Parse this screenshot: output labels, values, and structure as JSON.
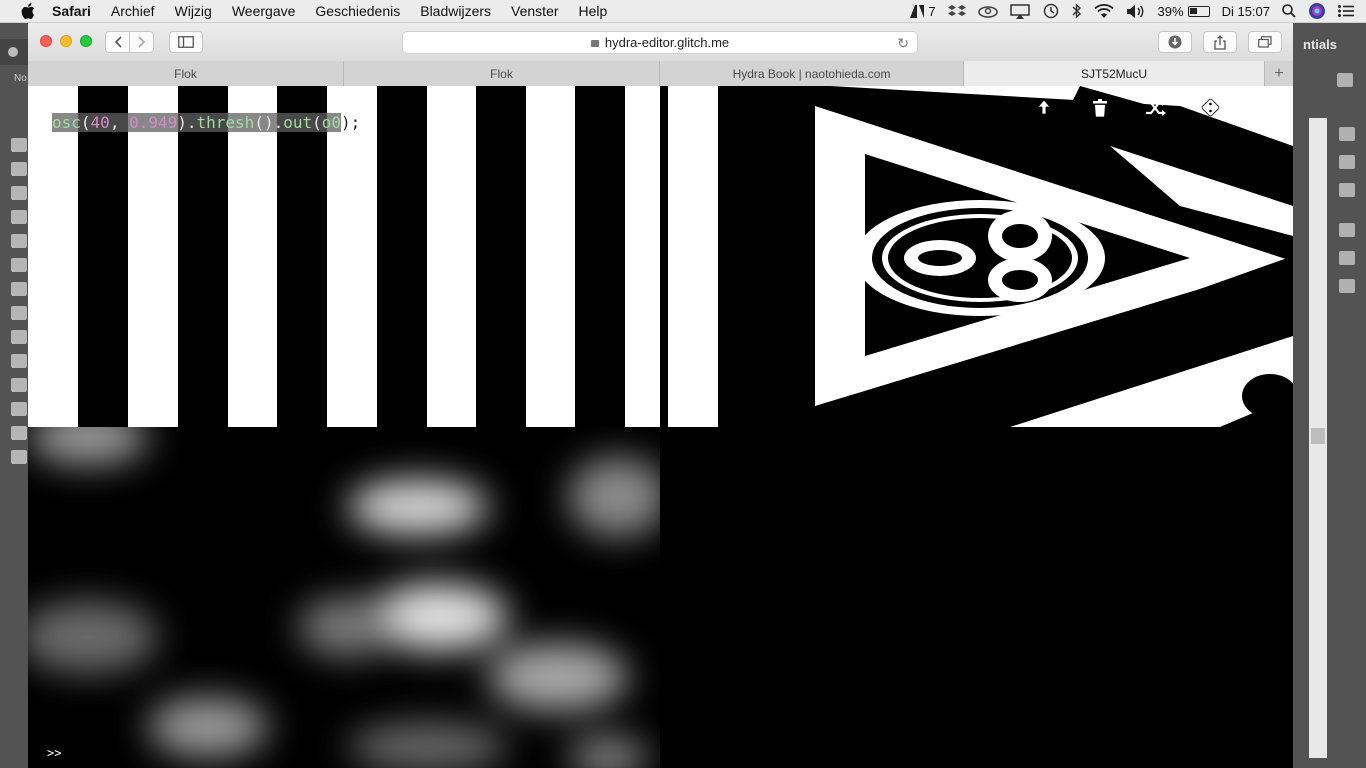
{
  "menubar": {
    "items": [
      "Safari",
      "Archief",
      "Wijzig",
      "Weergave",
      "Geschiedenis",
      "Bladwijzers",
      "Venster",
      "Help"
    ],
    "status": {
      "adobe_count": "7",
      "battery_percent": "39%",
      "clock": "Di 15:07"
    }
  },
  "background_app": {
    "workspace_label": "ntials",
    "left_label": "No"
  },
  "browser": {
    "address": "hydra-editor.glitch.me",
    "tabs": [
      {
        "label": "Flok",
        "active": false
      },
      {
        "label": "Flok",
        "active": false
      },
      {
        "label": "Hydra Book | naotohieda.com",
        "active": false
      },
      {
        "label": "SJT52MucU",
        "active": true
      }
    ]
  },
  "hydra": {
    "code_tokens": {
      "t1": "osc",
      "t2": "(",
      "t3": "40",
      "t4": ", ",
      "t5": "0.949",
      "t6": ").",
      "t7": "thresh",
      "t8": "().",
      "t9": "out",
      "t10": "(",
      "t11": "o0",
      "t12": ");"
    },
    "console_prompt": ">>",
    "icons": [
      "upload-icon",
      "trash-icon",
      "shuffle-icon",
      "dice-icon"
    ]
  },
  "colors": {
    "code_function": "#9fdc9f",
    "code_number": "#d58acb",
    "close": "#fc5f57",
    "minimize": "#fdbc2e",
    "maximize": "#28c840"
  }
}
